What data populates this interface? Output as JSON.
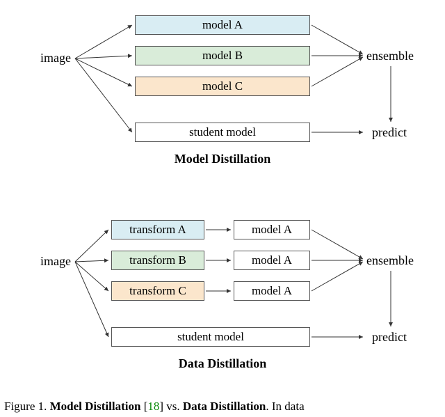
{
  "model_distillation": {
    "image_label": "image",
    "box_a": "model A",
    "box_b": "model B",
    "box_c": "model C",
    "student": "student model",
    "ensemble": "ensemble",
    "predict": "predict",
    "title": "Model Distillation"
  },
  "data_distillation": {
    "image_label": "image",
    "transform_a": "transform A",
    "transform_b": "transform B",
    "transform_c": "transform C",
    "model_a1": "model A",
    "model_a2": "model A",
    "model_a3": "model A",
    "student": "student model",
    "ensemble": "ensemble",
    "predict": "predict",
    "title": "Data Distillation"
  },
  "caption": {
    "pre": "Figure 1. ",
    "b1": "Model Distillation",
    "mid": " [",
    "cite": "18",
    "post": "] vs. ",
    "b2": "Data Distillation",
    "tail": ".  In data"
  }
}
